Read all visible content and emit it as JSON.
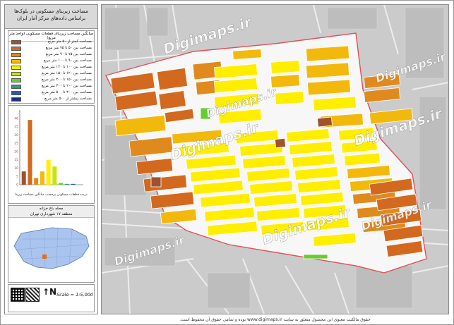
{
  "legend": {
    "title_line1": "مساحت زیربنای مسکونی در بلوک‌ها",
    "title_line2": "براساس داده‌های مرکز آمار ایران",
    "table_header": "میانگین مساحت زیربنای قطعات مسکونی (واحد متر مربع)",
    "items": [
      {
        "label": "مساحت کمتر از ۵۰ متر مربع",
        "color": "#a0522d"
      },
      {
        "label": "مساحت بین ۵۰ تا ۷۵ متر مربع",
        "color": "#d2691e"
      },
      {
        "label": "مساحت بین ۷۵ تا ۹۰ متر مربع",
        "color": "#e08a1e"
      },
      {
        "label": "مساحت بین ۹۰ تا ۱۰۰ متر مربع",
        "color": "#f2b90c"
      },
      {
        "label": "مساحت بین ۱۰۰ تا ۱۲۰ متر مربع",
        "color": "#ffee00"
      },
      {
        "label": "مساحت بین ۱۲۰ تا ۱۵۰ متر مربع",
        "color": "#c6e60a"
      },
      {
        "label": "مساحت بین ۱۵۰ تا ۲۰۰ متر مربع",
        "color": "#66cc33"
      },
      {
        "label": "مساحت بین ۲۰۰ تا ۳۰۰ متر مربع",
        "color": "#2e9c7a"
      },
      {
        "label": "مساحت بین ۳۰۰ تا ۵۰۰ متر مربع",
        "color": "#2a5aa8"
      },
      {
        "label": "مساحت بیشتر از ۵۰۰ متر مربع",
        "color": "#1f2f7a"
      }
    ]
  },
  "chart_data": {
    "type": "bar",
    "categories": [
      "1",
      "2",
      "3",
      "4",
      "5",
      "6",
      "7",
      "8",
      "9",
      "10"
    ],
    "values": [
      8,
      39,
      4,
      8,
      15,
      11,
      1,
      0.5,
      0.5,
      0
    ],
    "colors": [
      "#a0522d",
      "#d2691e",
      "#e08a1e",
      "#f2b90c",
      "#ffee00",
      "#c6e60a",
      "#66cc33",
      "#2e9c7a",
      "#2a5aa8",
      "#1f2f7a"
    ],
    "ylim": [
      0,
      45
    ],
    "yticks": [
      "40",
      "35",
      "30",
      "25",
      "20",
      "15",
      "10",
      "5",
      "0"
    ],
    "caption": "درصد قطعات مسکونی برحسب میانگین مساحت زیربنا"
  },
  "location": {
    "title_line1": "محله باغ خزانه",
    "title_line2": "منطقه ۱۷ شهرداری تهران"
  },
  "scale": {
    "label": "Scale = 1:5,000"
  },
  "watermark": "Digimaps.ir",
  "credit": "حقوق مالکیت معنوی این محصول متعلق به سایت www.digimaps.ir بوده و تمامی حقوق آن محفوظ است."
}
